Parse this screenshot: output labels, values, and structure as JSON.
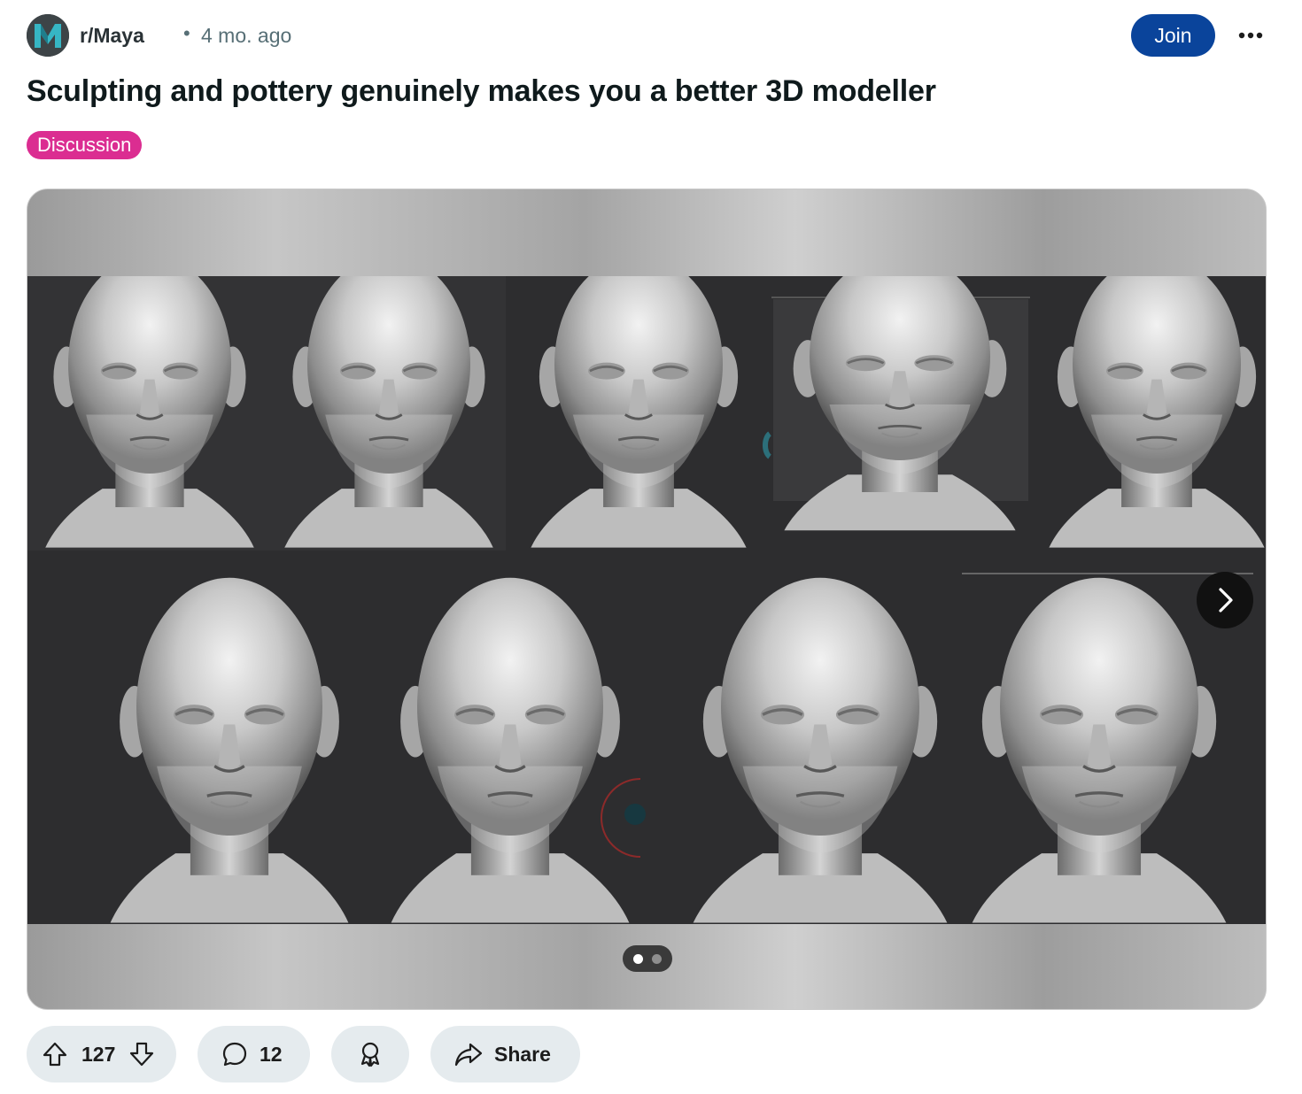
{
  "post": {
    "subreddit": "r/Maya",
    "separator": "•",
    "time_ago": "4 mo. ago",
    "join_label": "Join",
    "title": "Sculpting and pottery genuinely makes you a better 3D modeller",
    "flair": "Discussion"
  },
  "media": {
    "content": "3D head sculpt progression",
    "slide_count": 2,
    "current_slide": 1
  },
  "actions": {
    "upvotes": "127",
    "comments": "12",
    "share_label": "Share"
  },
  "icons": {
    "avatar": "maya-logo",
    "more": "more-horizontal-icon",
    "next": "chevron-right-icon",
    "upvote": "upvote-arrow-icon",
    "downvote": "downvote-arrow-icon",
    "comment": "comment-bubble-icon",
    "award": "award-icon",
    "share": "share-arrow-icon"
  },
  "colors": {
    "join_button": "#0a449b",
    "flair": "#db2d91",
    "action_pill": "#e5ebee",
    "muted_text": "#576f76"
  }
}
